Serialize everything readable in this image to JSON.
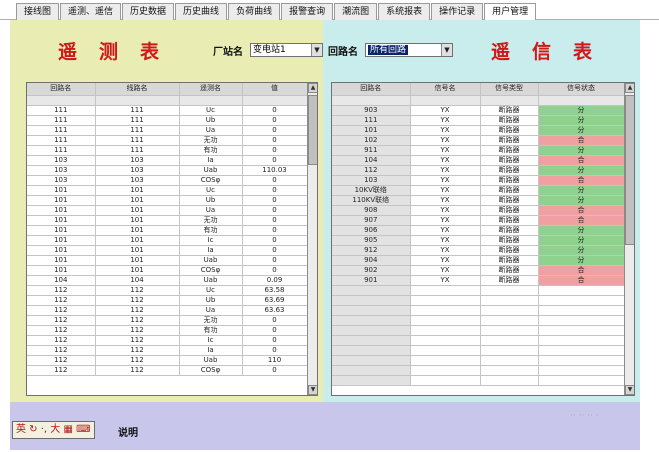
{
  "tabs": [
    {
      "label": "接线图",
      "active": false
    },
    {
      "label": "遥测、遥信",
      "active": false
    },
    {
      "label": "历史数据",
      "active": false
    },
    {
      "label": "历史曲线",
      "active": false
    },
    {
      "label": "负荷曲线",
      "active": false
    },
    {
      "label": "报警查询",
      "active": false
    },
    {
      "label": "潮流图",
      "active": false
    },
    {
      "label": "系统报表",
      "active": false
    },
    {
      "label": "操作记录",
      "active": false
    },
    {
      "label": "用户管理",
      "active": true
    }
  ],
  "telemetry": {
    "title": "遥测表",
    "station_label": "厂站名",
    "station_value": "变电站1",
    "columns": [
      "回路名",
      "线路名",
      "遥测名",
      "值"
    ],
    "rows": [
      [
        "111",
        "111",
        "Uc",
        "0"
      ],
      [
        "111",
        "111",
        "Ub",
        "0"
      ],
      [
        "111",
        "111",
        "Ua",
        "0"
      ],
      [
        "111",
        "111",
        "无功",
        "0"
      ],
      [
        "111",
        "111",
        "有功",
        "0"
      ],
      [
        "103",
        "103",
        "Ia",
        "0"
      ],
      [
        "103",
        "103",
        "Uab",
        "110.03"
      ],
      [
        "103",
        "103",
        "COSφ",
        "0"
      ],
      [
        "101",
        "101",
        "Uc",
        "0"
      ],
      [
        "101",
        "101",
        "Ub",
        "0"
      ],
      [
        "101",
        "101",
        "Ua",
        "0"
      ],
      [
        "101",
        "101",
        "无功",
        "0"
      ],
      [
        "101",
        "101",
        "有功",
        "0"
      ],
      [
        "101",
        "101",
        "Ic",
        "0"
      ],
      [
        "101",
        "101",
        "Ia",
        "0"
      ],
      [
        "101",
        "101",
        "Uab",
        "0"
      ],
      [
        "101",
        "101",
        "COSφ",
        "0"
      ],
      [
        "104",
        "104",
        "Uab",
        "0.09"
      ],
      [
        "112",
        "112",
        "Uc",
        "63.58"
      ],
      [
        "112",
        "112",
        "Ub",
        "63.69"
      ],
      [
        "112",
        "112",
        "Ua",
        "63.63"
      ],
      [
        "112",
        "112",
        "无功",
        "0"
      ],
      [
        "112",
        "112",
        "有功",
        "0"
      ],
      [
        "112",
        "112",
        "Ic",
        "0"
      ],
      [
        "112",
        "112",
        "Ia",
        "0"
      ],
      [
        "112",
        "112",
        "Uab",
        "110"
      ],
      [
        "112",
        "112",
        "COSφ",
        "0"
      ]
    ]
  },
  "telesignal": {
    "title": "遥信表",
    "circuit_label": "回路名",
    "circuit_value": "所有回路",
    "columns": [
      "回路名",
      "信号名",
      "信号类型",
      "信号状态"
    ],
    "rows": [
      [
        "903",
        "YX",
        "断路器",
        "分",
        "open"
      ],
      [
        "111",
        "YX",
        "断路器",
        "分",
        "open"
      ],
      [
        "101",
        "YX",
        "断路器",
        "分",
        "open"
      ],
      [
        "102",
        "YX",
        "断路器",
        "合",
        "closed"
      ],
      [
        "911",
        "YX",
        "断路器",
        "分",
        "open"
      ],
      [
        "104",
        "YX",
        "断路器",
        "合",
        "closed"
      ],
      [
        "112",
        "YX",
        "断路器",
        "分",
        "open"
      ],
      [
        "103",
        "YX",
        "断路器",
        "合",
        "closed"
      ],
      [
        "10KV联络",
        "YX",
        "断路器",
        "分",
        "open"
      ],
      [
        "110KV联络",
        "YX",
        "断路器",
        "分",
        "open"
      ],
      [
        "908",
        "YX",
        "断路器",
        "合",
        "closed"
      ],
      [
        "907",
        "YX",
        "断路器",
        "合",
        "closed"
      ],
      [
        "906",
        "YX",
        "断路器",
        "分",
        "open"
      ],
      [
        "905",
        "YX",
        "断路器",
        "分",
        "open"
      ],
      [
        "912",
        "YX",
        "断路器",
        "分",
        "open"
      ],
      [
        "904",
        "YX",
        "断路器",
        "分",
        "open"
      ],
      [
        "902",
        "YX",
        "断路器",
        "合",
        "closed"
      ],
      [
        "901",
        "YX",
        "断路器",
        "合",
        "closed"
      ]
    ],
    "blank_rows": 10
  },
  "colors": {
    "open": "#8fd18f",
    "closed": "#f0a0a0",
    "title": "#d01818"
  },
  "ime": {
    "text": "英 ↻ ·, 大 ▦ ⌨",
    "note": "说明"
  },
  "watermark": "·· ·· ·· ·"
}
